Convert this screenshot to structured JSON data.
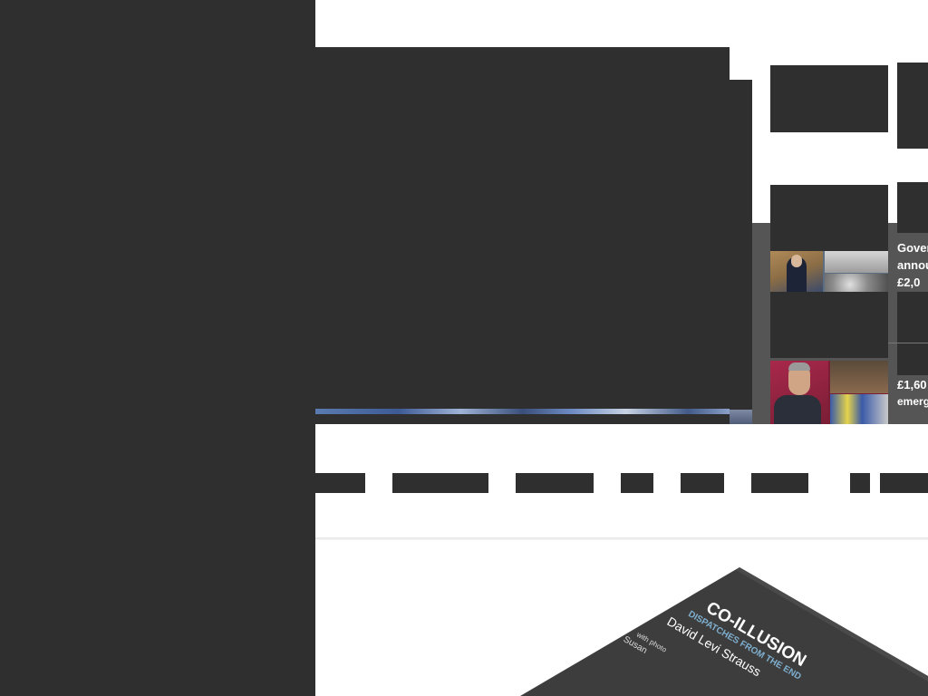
{
  "news": {
    "items": [
      {
        "lines": [
          "Gover",
          "annou",
          "£2,0"
        ]
      },
      {
        "lines": [
          "£1,60",
          "emerg"
        ]
      }
    ]
  },
  "book": {
    "title": "CO-ILLUSION",
    "subtitle": "DISPATCHES FROM THE END",
    "author": "David Levi Strauss",
    "photos_prefix": "with photo",
    "photographer_partial": "Susan"
  },
  "colors": {
    "dark_block": "#2f2f2f",
    "news_panel": "#555555",
    "book_cover": "#3d3d3d",
    "book_subtitle": "#7fb0d0"
  }
}
